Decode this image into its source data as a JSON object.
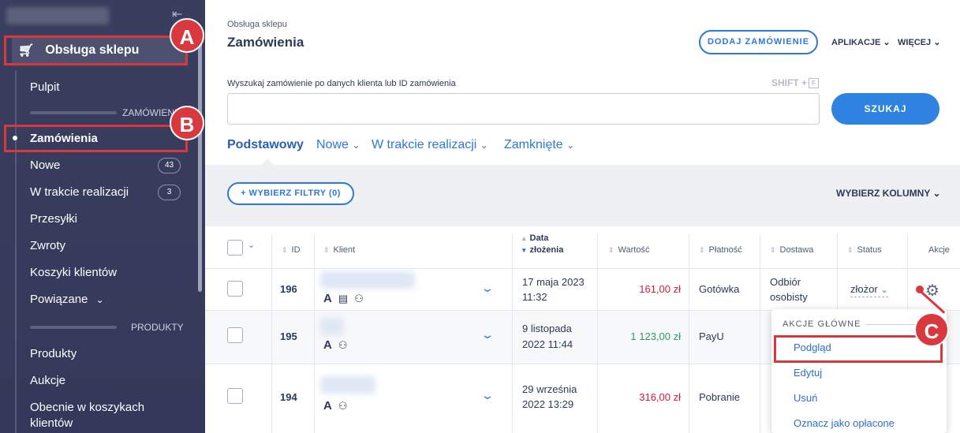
{
  "sidebar": {
    "section_title": "Obsługa sklepu",
    "items": [
      {
        "label": "Pulpit"
      },
      {
        "label": "Zamówienia"
      },
      {
        "label": "Nowe",
        "badge": "43"
      },
      {
        "label": "W trakcie realizacji",
        "badge": "3"
      },
      {
        "label": "Przesyłki"
      },
      {
        "label": "Zwroty"
      },
      {
        "label": "Koszyki klientów"
      },
      {
        "label": "Powiązane"
      },
      {
        "label": "Produkty"
      },
      {
        "label": "Aukcje"
      },
      {
        "label": "Obecnie w koszykach"
      },
      {
        "label": "klientów"
      }
    ],
    "divider_orders": "ZAMÓWIENIA",
    "divider_products": "PRODUKTY"
  },
  "header": {
    "breadcrumb": "Obsługa sklepu",
    "title": "Zamówienia",
    "add_order": "DODAJ ZAMÓWIENIE",
    "apps": "APLIKACJE",
    "more": "WIĘCEJ"
  },
  "search": {
    "label": "Wyszukaj zamówienie po danych klienta lub ID zamówienia",
    "shortcut": "SHIFT +",
    "shortcut_key": "F",
    "button": "SZUKAJ"
  },
  "tabs": [
    {
      "label": "Podstawowy"
    },
    {
      "label": "Nowe"
    },
    {
      "label": "W trakcie realizacji"
    },
    {
      "label": "Zamknięte"
    }
  ],
  "filters": {
    "button": "+ WYBIERZ FILTRY (0)",
    "columns": "WYBIERZ KOLUMNY"
  },
  "table": {
    "headers": {
      "id": "ID",
      "client": "Klient",
      "date_1": "Data",
      "date_2": "złożenia",
      "value": "Wartość",
      "payment": "Płatność",
      "delivery": "Dostawa",
      "status": "Status",
      "actions": "Akcje"
    },
    "rows": [
      {
        "id": "196",
        "date_1": "17 maja 2023",
        "date_2": "11:32",
        "value": "161,00 zł",
        "payment": "Gotówka",
        "delivery_1": "Odbiór",
        "delivery_2": "osobisty",
        "status": "złożor"
      },
      {
        "id": "195",
        "date_1": "9 listopada",
        "date_2": "2022 11:44",
        "value": "1 123,00 zł",
        "payment": "PayU"
      },
      {
        "id": "194",
        "date_1": "29 września",
        "date_2": "2022 13:29",
        "value": "316,00 zł",
        "payment": "Pobranie"
      }
    ]
  },
  "actions_menu": {
    "heading": "AKCJE GŁÓWNE",
    "items": [
      "Podgląd",
      "Edytuj",
      "Usuń",
      "Oznacz jako opłacone"
    ]
  },
  "annotations": [
    "A",
    "B",
    "C"
  ],
  "colors": {
    "accent": "#2e78d6",
    "annotation": "#d9383f",
    "sidebar": "#3a3e5e",
    "price_red": "#d0193f",
    "price_green": "#2d9a5f"
  }
}
